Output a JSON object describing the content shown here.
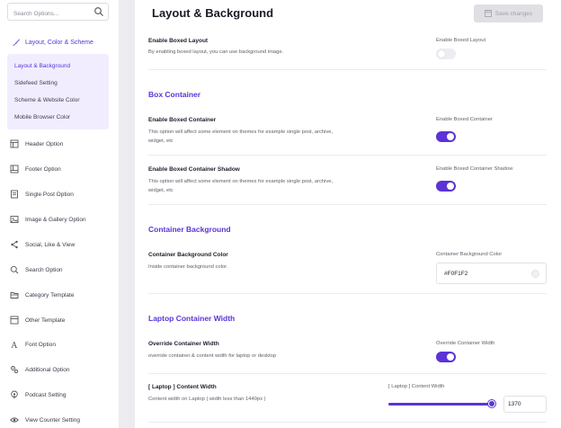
{
  "sidebar": {
    "search_placeholder": "Search Options...",
    "active_item": "Layout, Color & Scheme",
    "sub_items": [
      "Layout & Background",
      "Sidefeed Setting",
      "Scheme & Website Color",
      "Mobile Browser Color"
    ],
    "items": [
      {
        "label": "Header Option",
        "icon": "header-icon"
      },
      {
        "label": "Footer Option",
        "icon": "footer-icon"
      },
      {
        "label": "Single Post Option",
        "icon": "document-icon"
      },
      {
        "label": "Image & Gallery Option",
        "icon": "image-icon"
      },
      {
        "label": "Social, Like & View",
        "icon": "share-icon"
      },
      {
        "label": "Search Option",
        "icon": "search-icon"
      },
      {
        "label": "Category Template",
        "icon": "folder-icon"
      },
      {
        "label": "Other Template",
        "icon": "template-icon"
      },
      {
        "label": "Font Option",
        "icon": "font-icon"
      },
      {
        "label": "Additional Option",
        "icon": "gears-icon"
      },
      {
        "label": "Podcast Setting",
        "icon": "podcast-icon"
      },
      {
        "label": "View Counter Setting",
        "icon": "eye-icon"
      }
    ]
  },
  "header": {
    "title": "Layout & Background",
    "save_label": "Save changes"
  },
  "settings": {
    "boxed_layout": {
      "title": "Enable Boxed Layout",
      "desc": "By enabling boxed layout, you can use background image.",
      "control_label": "Enable Boxed Layout",
      "enabled": false
    },
    "box_container_heading": "Box Container",
    "boxed_container": {
      "title": "Enable Boxed Container",
      "desc_line1": "This option will affect some element on themes for example single post, archive,",
      "desc_line2": "widget, etc",
      "control_label": "Enable Boxed Container",
      "enabled": true
    },
    "boxed_container_shadow": {
      "title": "Enable Boxed Container Shadow",
      "desc_line1": "This option will affect some element on themes for example single post, archive,",
      "desc_line2": "widget, etc",
      "control_label": "Enable Boxed Container Shadow",
      "enabled": true
    },
    "container_background_heading": "Container Background",
    "container_bg_color": {
      "title": "Container Background Color",
      "desc": "Inside container background color.",
      "control_label": "Container Background Color",
      "value": "#F0F1F2"
    },
    "laptop_width_heading": "Laptop Container Width",
    "override_width": {
      "title": "Override Container Width",
      "desc": "override container & content width for laptop or desktop",
      "control_label": "Override Container Width",
      "enabled": true
    },
    "laptop_content_width": {
      "title": "[ Laptop ] Content Width",
      "desc": "Content width on Laptop ( width less than 1440px )",
      "control_label": "[ Laptop ] Content Width",
      "value": "1370"
    }
  },
  "colors": {
    "accent": "#5b33d6",
    "sub_nav_bg": "#f1edff",
    "disabled_button": "#dfdfe4"
  }
}
